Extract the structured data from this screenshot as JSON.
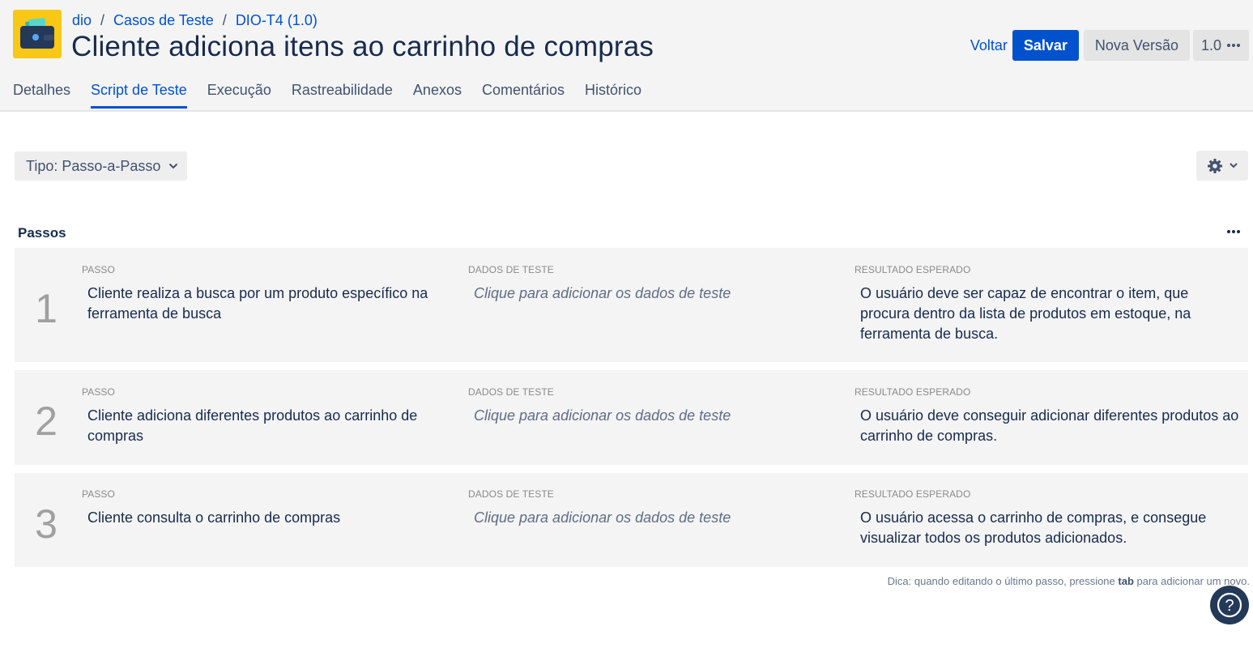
{
  "breadcrumb": {
    "project": "dio",
    "section": "Casos de Teste",
    "item": "DIO-T4 (1.0)"
  },
  "title": "Cliente adiciona itens ao carrinho de compras",
  "actions": {
    "back": "Voltar",
    "save": "Salvar",
    "new_version": "Nova Versão",
    "version": "1.0"
  },
  "tabs": [
    "Detalhes",
    "Script de Teste",
    "Execução",
    "Rastreabilidade",
    "Anexos",
    "Comentários",
    "Histórico"
  ],
  "active_tab": "Script de Teste",
  "type_select": {
    "label": "Tipo: Passo-a-Passo"
  },
  "steps_section": {
    "title": "Passos"
  },
  "column_labels": {
    "step": "PASSO",
    "data": "DADOS DE TESTE",
    "result": "RESULTADO ESPERADO"
  },
  "steps": [
    {
      "number": "1",
      "step": "Cliente realiza a busca por um produto específico na ferramenta de busca",
      "data": "Clique para adicionar os dados de teste",
      "result": "O usuário deve ser capaz de encontrar o item, que procura dentro da lista de produtos em estoque, na ferramenta de busca."
    },
    {
      "number": "2",
      "step": "Cliente adiciona diferentes produtos ao carrinho de compras",
      "data": "Clique para adicionar os dados de teste",
      "result": "O usuário deve conseguir adicionar diferentes  produtos ao carrinho de compras."
    },
    {
      "number": "3",
      "step": "Cliente consulta o carrinho de compras",
      "data": "Clique para adicionar os dados de teste",
      "result": "O usuário acessa o carrinho de compras, e consegue visualizar todos os produtos adicionados."
    }
  ],
  "hint": {
    "prefix": "Dica: quando editando o último passo, pressione",
    "key": "tab",
    "suffix": "para adicionar um novo."
  },
  "help": {
    "label": "?"
  },
  "colors": {
    "accent": "#0052cc",
    "logo": "#f9c716",
    "step_bg": "#f4f4f4",
    "help_bg": "#243858"
  }
}
